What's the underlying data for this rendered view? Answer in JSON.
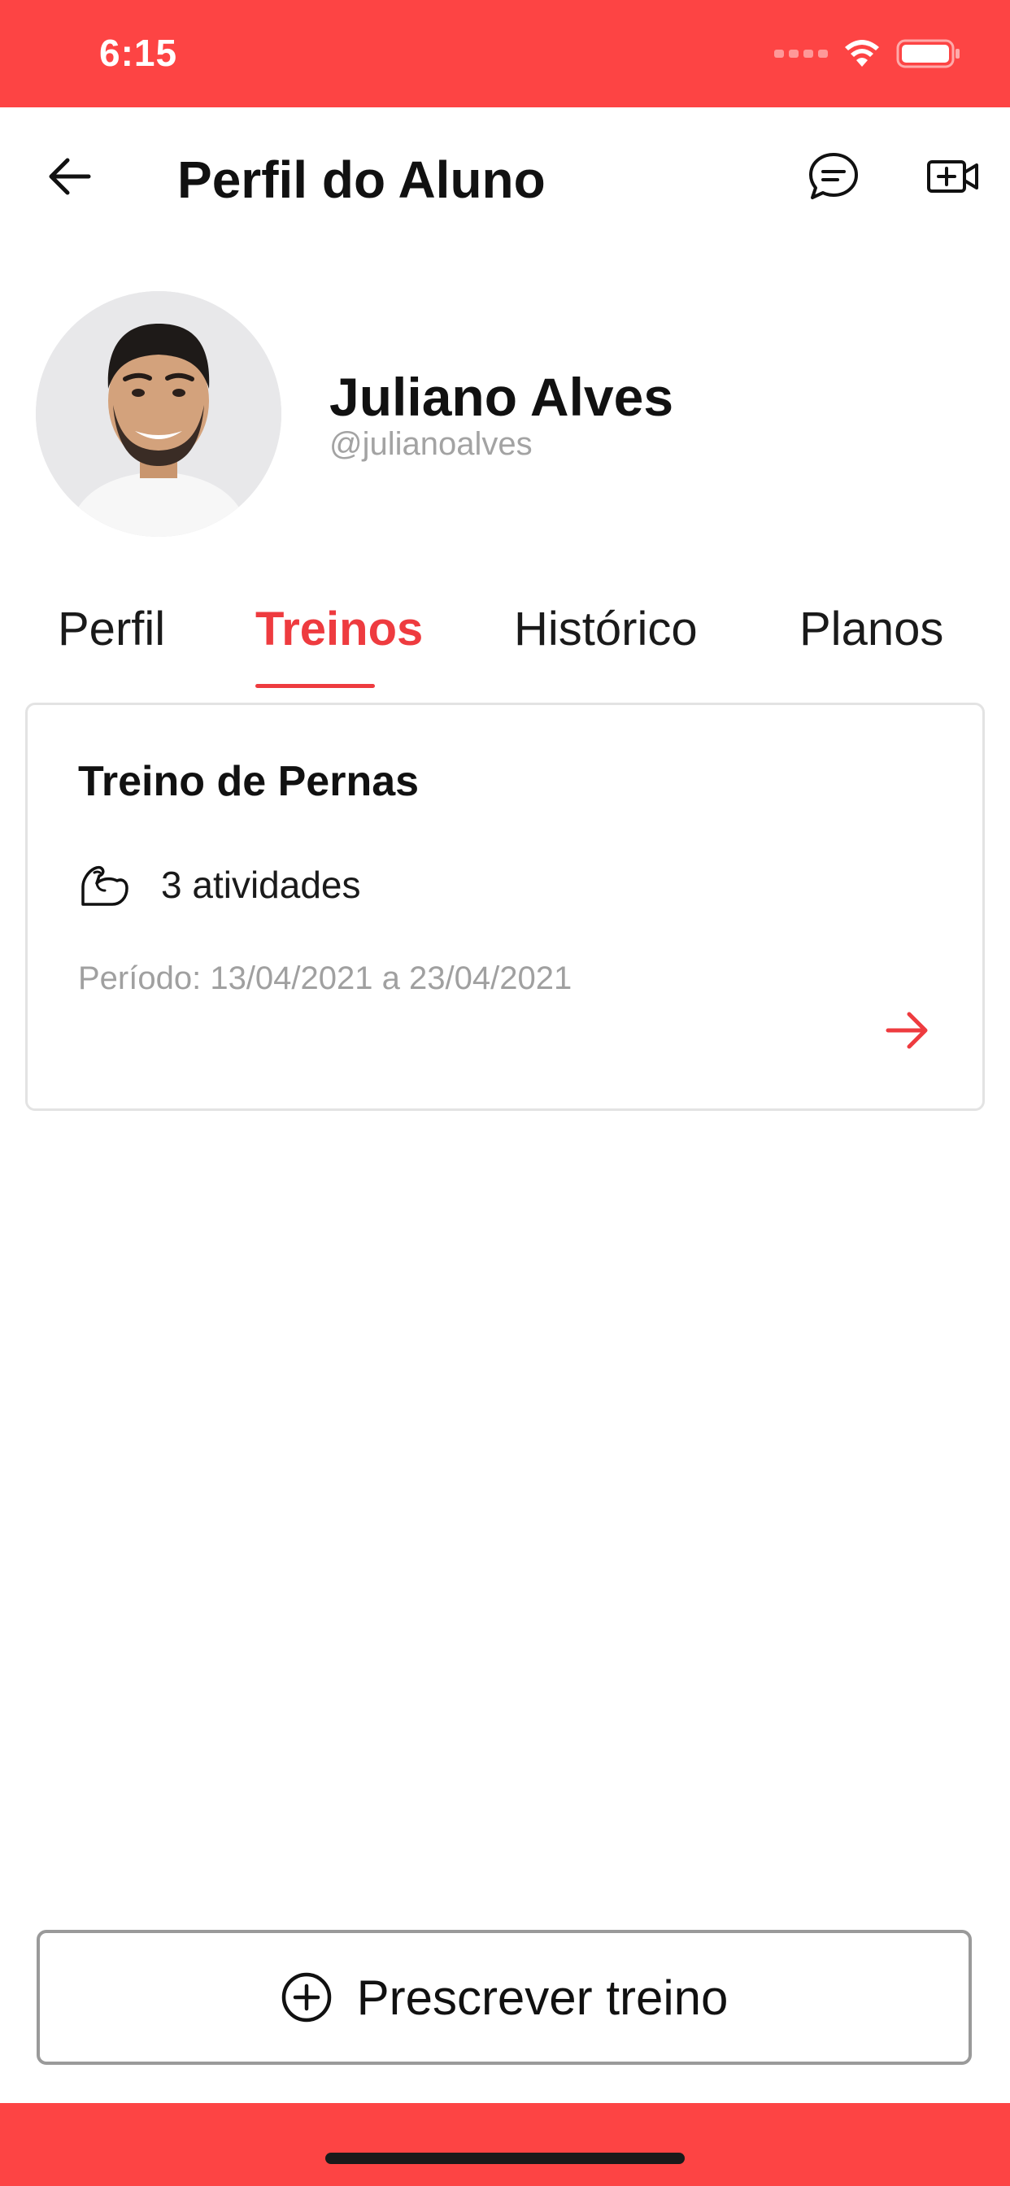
{
  "status_bar": {
    "time": "6:15",
    "wifi_icon": "wifi-icon",
    "battery_icon": "battery-icon",
    "background": "#fd4444"
  },
  "header": {
    "title": "Perfil do Aluno",
    "back_icon": "arrow-left-icon",
    "chat_icon": "chat-bubble-icon",
    "video_icon": "video-add-icon"
  },
  "student": {
    "name": "Juliano Alves",
    "handle": "@julianoalves"
  },
  "tabs": [
    {
      "label": "Perfil",
      "active": false
    },
    {
      "label": "Treinos",
      "active": true
    },
    {
      "label": "Histórico",
      "active": false
    },
    {
      "label": "Planos",
      "active": false
    }
  ],
  "workout_card": {
    "title": "Treino de Pernas",
    "activities_icon": "flexed-arm-icon",
    "activities": "3 atividades",
    "period": "Período: 13/04/2021 a 23/04/2021",
    "arrow_icon": "arrow-right-icon"
  },
  "prescribe_button": {
    "icon": "plus-circle-icon",
    "label": "Prescrever treino"
  },
  "colors": {
    "accent": "#ee3b3f",
    "bars": "#fd4444",
    "muted_text": "#a0a0a0"
  }
}
